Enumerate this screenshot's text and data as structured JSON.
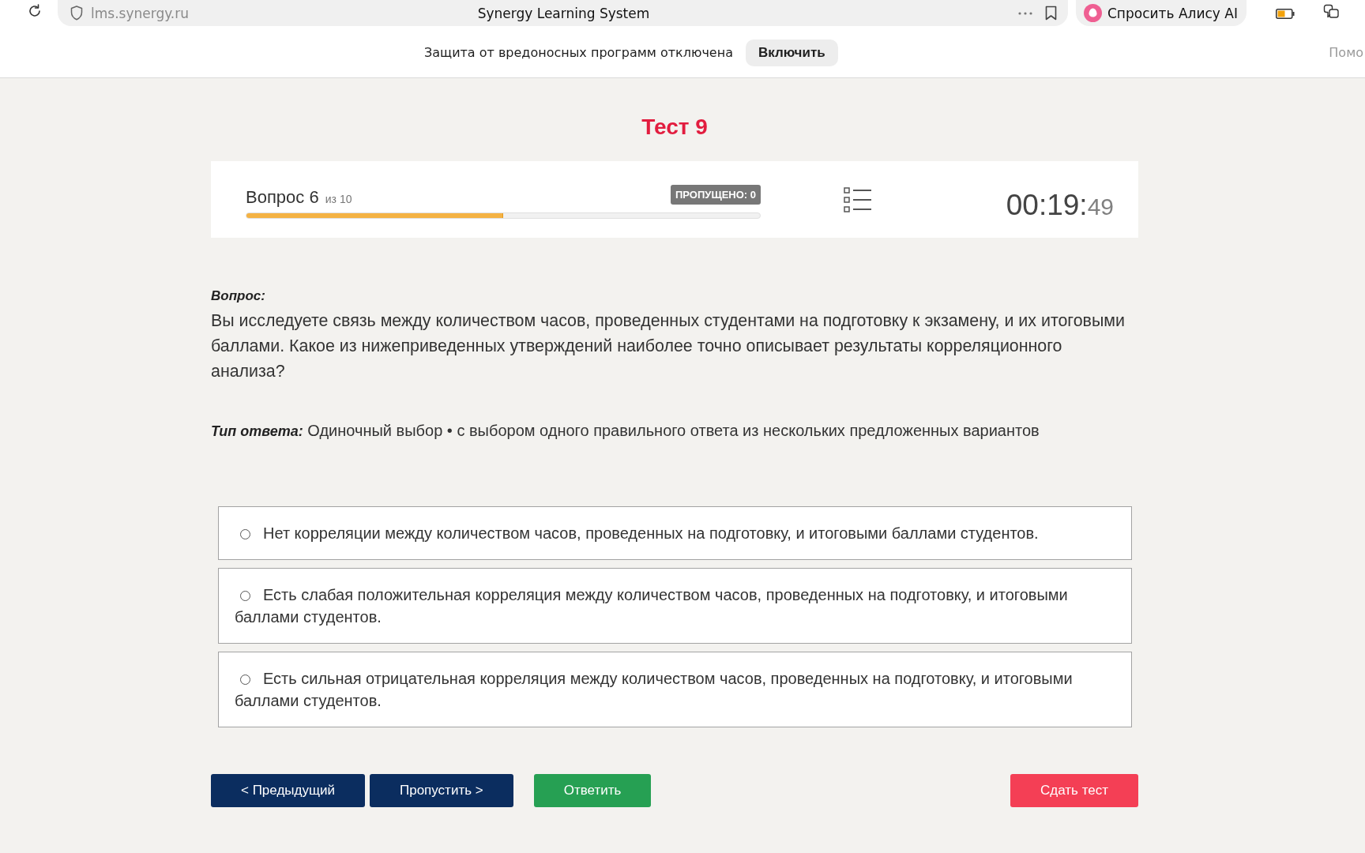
{
  "browser": {
    "url": "lms.synergy.ru",
    "title": "Synergy Learning System",
    "alice_button": "Спросить Алису AI"
  },
  "security_bar": {
    "message": "Защита от вредоносных программ отключена",
    "button": "Включить",
    "side_link": "Помо"
  },
  "test": {
    "title": "Тест 9"
  },
  "progress": {
    "question_label": "Вопрос 6",
    "question_total": "из 10",
    "skipped_badge": "ПРОПУЩЕНО: 0",
    "level": 0.5,
    "timer_main": "00:19:",
    "timer_seconds": "49"
  },
  "question": {
    "heading": "Вопрос:",
    "text": "Вы исследуете связь между количеством часов, проведенных студентами на подготовку к экзамену, и их итоговыми баллами. Какое из нижеприведенных утверждений наиболее точно описывает результаты корреляционного анализа?",
    "answer_type_label": "Тип ответа:",
    "answer_type": "Одиночный выбор • с выбором одного правильного ответа из нескольких предложенных вариантов"
  },
  "options": [
    {
      "text": "Нет корреляции между количеством часов, проведенных на подготовку, и итоговыми баллами студентов.",
      "selected": false
    },
    {
      "text": "Есть слабая положительная корреляция между количеством часов, проведенных на подготовку, и итоговыми баллами студентов.",
      "selected": false
    },
    {
      "text": "Есть сильная отрицательная корреляция между количеством часов, проведенных на подготовку, и итоговыми баллами студентов.",
      "selected": false
    }
  ],
  "buttons": [
    {
      "label": "< Предыдущий",
      "kind": "nav"
    },
    {
      "label": "Пропустить >",
      "kind": "nav"
    },
    {
      "label": "Ответить",
      "kind": "answer"
    },
    {
      "label": "Сдать тест",
      "kind": "submit"
    }
  ]
}
